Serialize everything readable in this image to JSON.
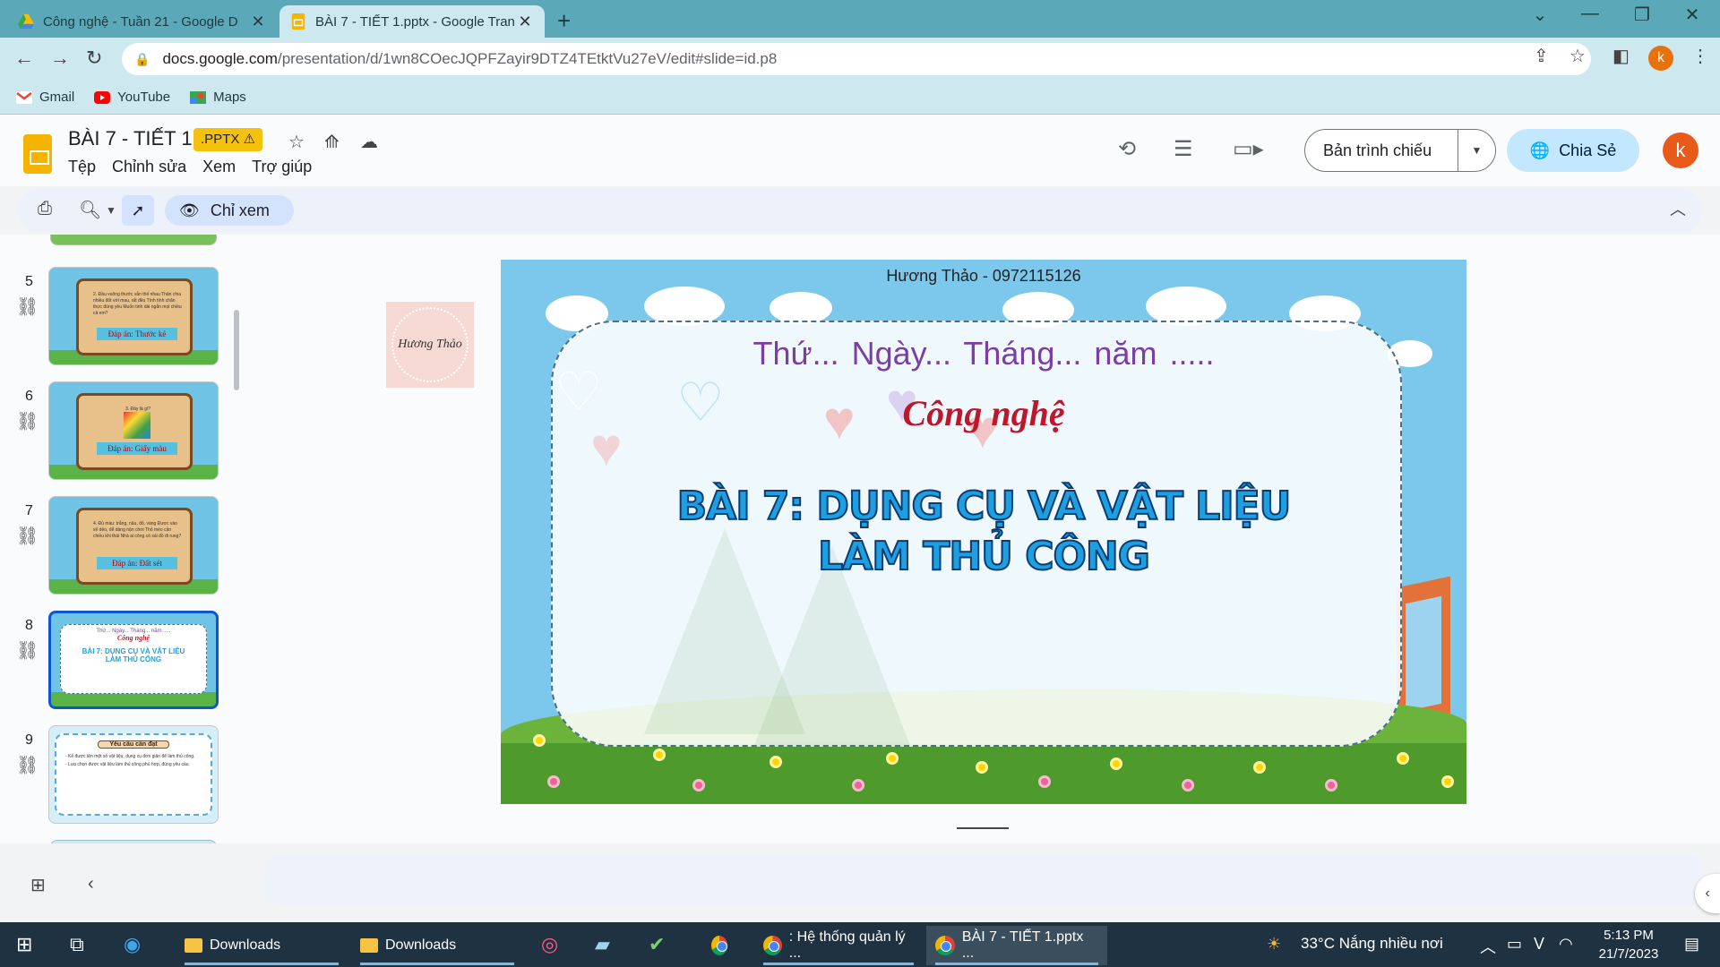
{
  "browser": {
    "tabs": [
      {
        "title": "Công nghệ - Tuần 21 - Google D",
        "active": false,
        "icon": "google-drive-icon"
      },
      {
        "title": "BÀI 7 - TIẾT 1.pptx - Google Tran",
        "active": true,
        "icon": "google-slides-icon"
      }
    ],
    "url_domain": "docs.google.com",
    "url_path": "/presentation/d/1wn8COecJQPFZayir9DTZ4TEtktVu27eV/edit#slide=id.p8",
    "profile_initial": "k",
    "bookmarks": [
      {
        "label": "Gmail",
        "icon": "gmail-icon"
      },
      {
        "label": "YouTube",
        "icon": "youtube-icon"
      },
      {
        "label": "Maps",
        "icon": "maps-icon"
      }
    ]
  },
  "app": {
    "doc_title": "BÀI 7 - TIẾT 1",
    "badge": ".PPTX ⚠",
    "menus": [
      "Tệp",
      "Chỉnh sửa",
      "Xem",
      "Trợ giúp"
    ],
    "present_label": "Bản trình chiếu",
    "share_label": "Chia Sẻ",
    "avatar_initial": "k",
    "view_only_label": "Chỉ xem"
  },
  "filmstrip": {
    "slides": [
      {
        "number": "5",
        "answer": "Đáp án: Thước kẻ",
        "text": "2. Đầu vuông thước vẫn thế nhau\nThân chia nhiều đốt với mau, rất đều\nTính tính chăn thực đúng yêu\nMuốn tinh dài ngắn mọi chiều cả em?"
      },
      {
        "number": "6",
        "answer": "Đáp án: Giấy màu",
        "text": "3. Đây là gì?"
      },
      {
        "number": "7",
        "answer": "Đáp án: Đất sét",
        "text": "4. Đủ màu: trắng, nâu, đỏ, vàng\nĐược vào xế dẻo, dễ dàng nặn chơi\nThỏ mèo cần chiều khi thái\nNhà ai công có sái đồ đi rung?"
      },
      {
        "number": "8",
        "selected": true,
        "date": "Thứ... Ngày... Tháng... năm .....",
        "subject": "Công nghệ",
        "title": "BÀI 7: DỤNG CỤ VÀ VẬT LIỆU LÀM THỦ CÔNG"
      },
      {
        "number": "9",
        "heading": "Yêu cầu cần đạt",
        "bullets": [
          "- Kể được tên một số vật liệu, dụng cụ đơn giản để làm thủ công.",
          "- Lựa chọn được vật liệu làm thủ công phù hợp, đúng yêu cầu."
        ]
      }
    ]
  },
  "slide": {
    "credit": "Hương Thảo - 0972115126",
    "date_line": "Thứ...   Ngày... Tháng...   năm .....",
    "subject": "Công nghệ",
    "title_line1": "BÀI 7: DỤNG CỤ VÀ VẬT LIỆU",
    "title_line2": "LÀM THỦ CÔNG",
    "watermark": "Hương Thảo"
  },
  "taskbar": {
    "items": [
      {
        "label": "Downloads",
        "icon": "folder-icon"
      },
      {
        "label": "Downloads",
        "icon": "folder-icon"
      },
      {
        "label": ": Hệ thống quản lý ...",
        "icon": "chrome-icon"
      },
      {
        "label": "BÀI 7 - TIẾT 1.pptx ...",
        "icon": "chrome-icon"
      }
    ],
    "weather": "33°C  Nắng nhiều nơi",
    "time": "5:13 PM",
    "date": "21/7/2023"
  }
}
